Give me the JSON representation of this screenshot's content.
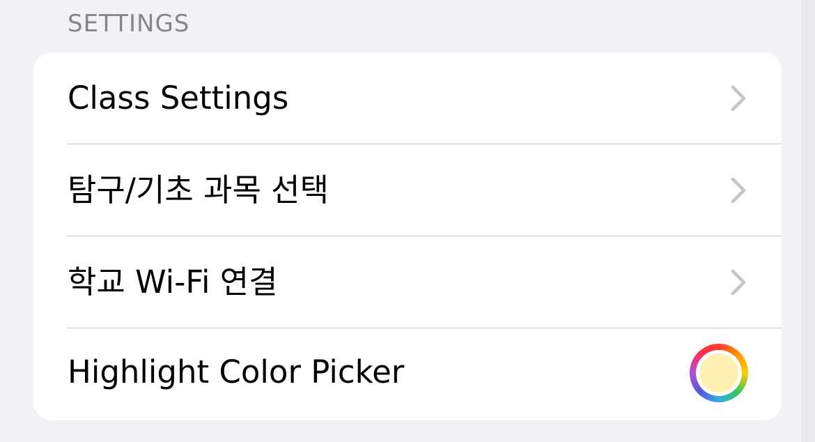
{
  "section": {
    "header": "SETTINGS"
  },
  "rows": [
    {
      "label": "Class Settings",
      "accessory": "chevron-right-icon"
    },
    {
      "label": "탐구/기초 과목 선택",
      "accessory": "chevron-right-icon"
    },
    {
      "label": "학교 Wi-Fi 연결",
      "accessory": "chevron-right-icon"
    },
    {
      "label": "Highlight Color Picker",
      "accessory": "color-well"
    }
  ],
  "highlight_color": "#fff0b3",
  "colors": {
    "background": "#f2f1f6",
    "card": "#ffffff",
    "header_text": "#86858b",
    "chevron": "#c4c4c7",
    "divider": "#c6c6c8"
  }
}
